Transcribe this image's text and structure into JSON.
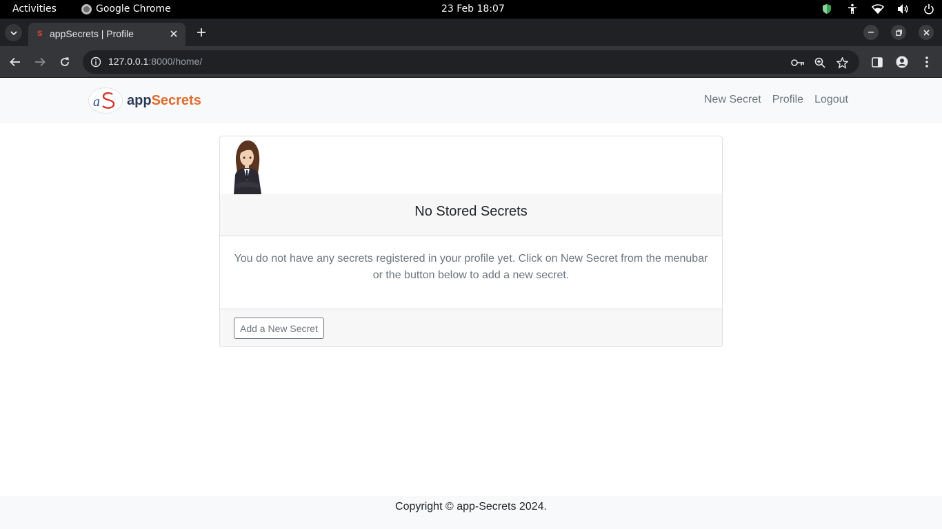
{
  "system_bar": {
    "activities": "Activities",
    "app_name": "Google Chrome",
    "clock": "23 Feb  18:07"
  },
  "browser": {
    "tab_title": "appSecrets | Profile",
    "url_host": "127.0.0.1",
    "url_rest": ":8000/home/"
  },
  "site": {
    "brand_prefix": "app",
    "brand_accent": "Secrets",
    "logo_letters": "aS",
    "nav": {
      "new_secret": "New Secret",
      "profile": "Profile",
      "logout": "Logout"
    }
  },
  "card": {
    "header": "No Stored Secrets",
    "body": "You do not have any secrets registered in your profile yet. Click on New Secret from the menubar or the button below to add a new secret.",
    "button": "Add a New Secret"
  },
  "footer": {
    "text": "Copyright © app-Secrets 2024."
  },
  "colors": {
    "brand_dark": "#2b3a55",
    "brand_accent": "#e06a2b",
    "navbar_bg": "#f8f9fa",
    "muted_text": "#6c757d"
  }
}
